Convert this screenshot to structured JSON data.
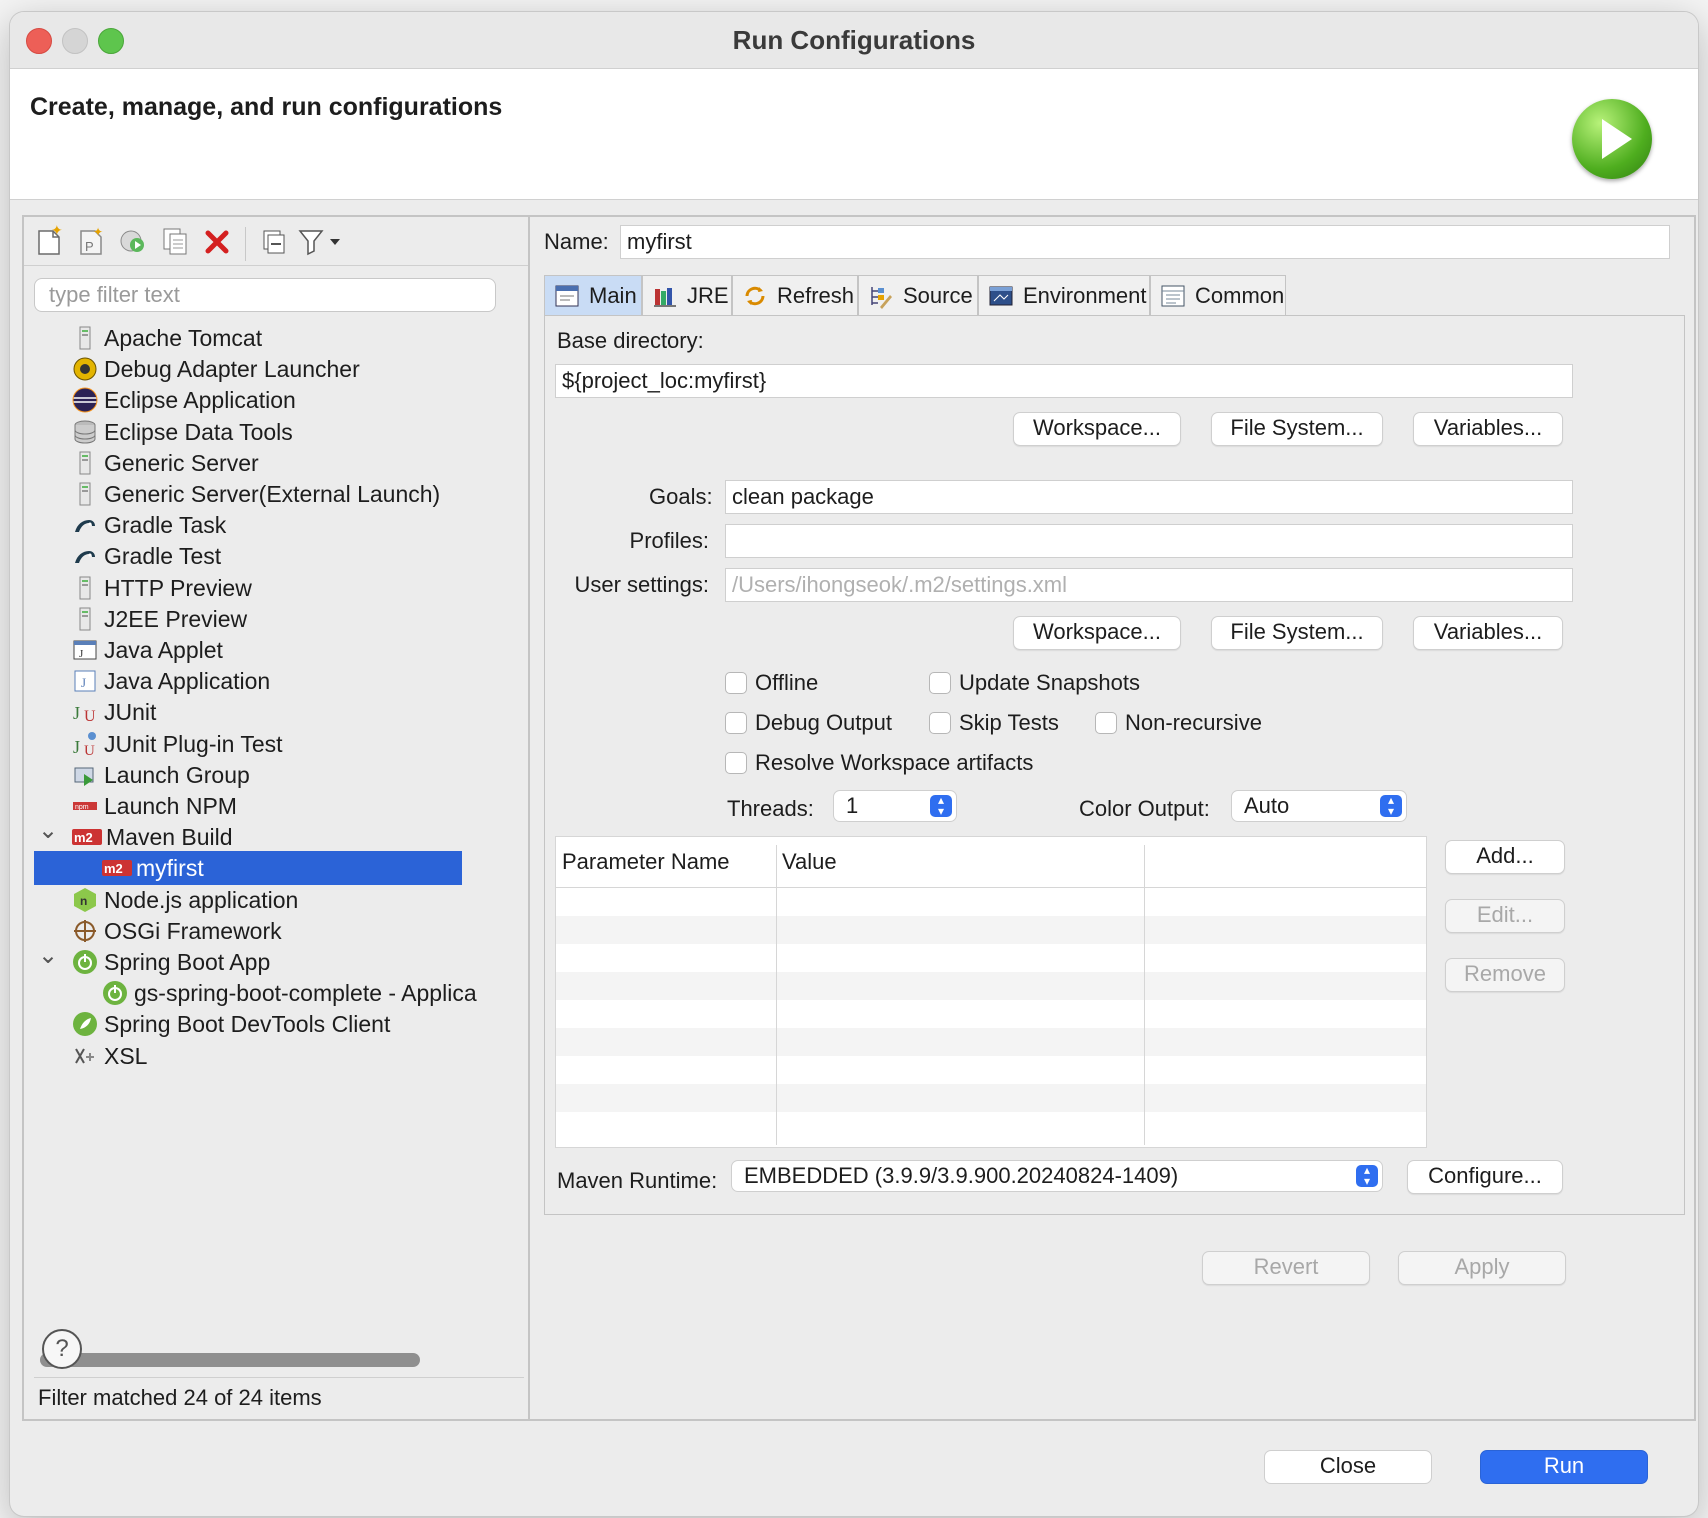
{
  "window": {
    "title": "Run Configurations"
  },
  "banner": {
    "title": "Create, manage, and run configurations"
  },
  "left": {
    "filter_placeholder": "type filter text",
    "toolbar": [
      "new-configuration-icon",
      "new-prototype-icon",
      "export-icon",
      "duplicate-icon",
      "delete-icon",
      "collapse-all-icon",
      "filter-icon"
    ],
    "items": [
      {
        "label": "Apache Tomcat",
        "icon": "server-icon",
        "level": 0
      },
      {
        "label": "Debug Adapter Launcher",
        "icon": "debug-adapter-icon",
        "level": 0
      },
      {
        "label": "Eclipse Application",
        "icon": "eclipse-icon",
        "level": 0
      },
      {
        "label": "Eclipse Data Tools",
        "icon": "database-icon",
        "level": 0
      },
      {
        "label": "Generic Server",
        "icon": "server-icon",
        "level": 0
      },
      {
        "label": "Generic Server(External Launch)",
        "icon": "server-icon",
        "level": 0
      },
      {
        "label": "Gradle Task",
        "icon": "gradle-icon",
        "level": 0
      },
      {
        "label": "Gradle Test",
        "icon": "gradle-icon",
        "level": 0
      },
      {
        "label": "HTTP Preview",
        "icon": "server-icon",
        "level": 0
      },
      {
        "label": "J2EE Preview",
        "icon": "server-icon",
        "level": 0
      },
      {
        "label": "Java Applet",
        "icon": "java-applet-icon",
        "level": 0
      },
      {
        "label": "Java Application",
        "icon": "java-application-icon",
        "level": 0
      },
      {
        "label": "JUnit",
        "icon": "junit-icon",
        "level": 0
      },
      {
        "label": "JUnit Plug-in Test",
        "icon": "junit-plugin-icon",
        "level": 0
      },
      {
        "label": "Launch Group",
        "icon": "launch-group-icon",
        "level": 0
      },
      {
        "label": "Launch NPM",
        "icon": "npm-icon",
        "level": 0
      },
      {
        "label": "Maven Build",
        "icon": "maven-icon",
        "level": 0,
        "expanded": true
      },
      {
        "label": "myfirst",
        "icon": "maven-icon",
        "level": 1,
        "selected": true
      },
      {
        "label": "Node.js application",
        "icon": "nodejs-icon",
        "level": 0
      },
      {
        "label": "OSGi Framework",
        "icon": "osgi-icon",
        "level": 0
      },
      {
        "label": "Spring Boot App",
        "icon": "spring-boot-icon",
        "level": 0,
        "expanded": true
      },
      {
        "label": "gs-spring-boot-complete - Applica",
        "icon": "spring-boot-icon",
        "level": 1
      },
      {
        "label": "Spring Boot DevTools Client",
        "icon": "spring-devtools-icon",
        "level": 0
      },
      {
        "label": "XSL",
        "icon": "xsl-icon",
        "level": 0
      }
    ],
    "status": "Filter matched 24 of 24 items"
  },
  "right": {
    "name_label": "Name:",
    "name_value": "myfirst",
    "tabs": [
      {
        "label": "Main",
        "icon": "main-tab-icon",
        "active": true
      },
      {
        "label": "JRE",
        "icon": "jre-icon"
      },
      {
        "label": "Refresh",
        "icon": "refresh-icon"
      },
      {
        "label": "Source",
        "icon": "source-icon"
      },
      {
        "label": "Environment",
        "icon": "environment-icon"
      },
      {
        "label": "Common",
        "icon": "common-icon"
      }
    ],
    "base_dir_label": "Base directory:",
    "base_dir_value": "${project_loc:myfirst}",
    "workspace_btn": "Workspace...",
    "filesystem_btn": "File System...",
    "variables_btn": "Variables...",
    "goals_label": "Goals:",
    "goals_value": "clean package",
    "profiles_label": "Profiles:",
    "profiles_value": "",
    "user_settings_label": "User settings:",
    "user_settings_placeholder": "/Users/ihongseok/.m2/settings.xml",
    "checkboxes": {
      "offline": "Offline",
      "update_snapshots": "Update Snapshots",
      "debug_output": "Debug Output",
      "skip_tests": "Skip Tests",
      "non_recursive": "Non-recursive",
      "resolve_workspace": "Resolve Workspace artifacts"
    },
    "threads_label": "Threads:",
    "threads_value": "1",
    "color_output_label": "Color Output:",
    "color_output_value": "Auto",
    "param_table": {
      "col_name": "Parameter Name",
      "col_value": "Value"
    },
    "add_btn": "Add...",
    "edit_btn": "Edit...",
    "remove_btn": "Remove",
    "maven_runtime_label": "Maven Runtime:",
    "maven_runtime_value": "EMBEDDED (3.9.9/3.9.900.20240824-1409)",
    "configure_btn": "Configure...",
    "revert_btn": "Revert",
    "apply_btn": "Apply"
  },
  "footer": {
    "help": "?",
    "close_btn": "Close",
    "run_btn": "Run"
  },
  "colors": {
    "accent": "#2b63d7",
    "run_button": "#2f6ef0"
  }
}
